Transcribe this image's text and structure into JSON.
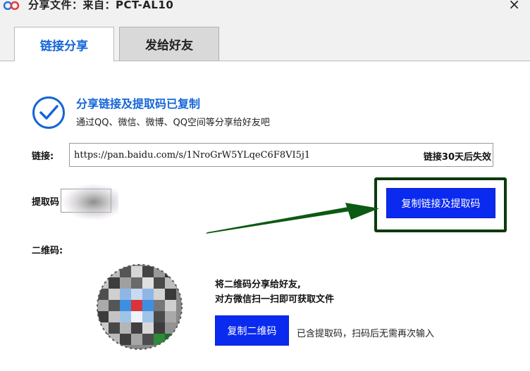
{
  "window": {
    "title": "分享文件：来自：PCT-AL10",
    "close_glyph": "×"
  },
  "tabs": [
    {
      "label": "链接分享",
      "active": true
    },
    {
      "label": "发给好友",
      "active": false
    }
  ],
  "success": {
    "title": "分享链接及提取码已复制",
    "subtitle": "通过QQ、微信、微博、QQ空间等分享给好友吧"
  },
  "link": {
    "label": "链接:",
    "url": "https://pan.baidu.com/s/1NroGrW5YLqeC6F8VI5j1",
    "expiry": "链接30天后失效"
  },
  "code": {
    "label": "提取码"
  },
  "buttons": {
    "copy_link": "复制链接及提取码",
    "copy_qr": "复制二维码"
  },
  "qr": {
    "label": "二维码:",
    "desc_line1": "将二维码分享给好友,",
    "desc_line2": "对方微信扫一扫即可获取文件",
    "note": "已含提取码，扫码后无需再次输入"
  },
  "colors": {
    "accent": "#1565d8",
    "button": "#0a2af0",
    "highlight_frame": "#0c3a0c",
    "arrow": "#0c5a14"
  }
}
